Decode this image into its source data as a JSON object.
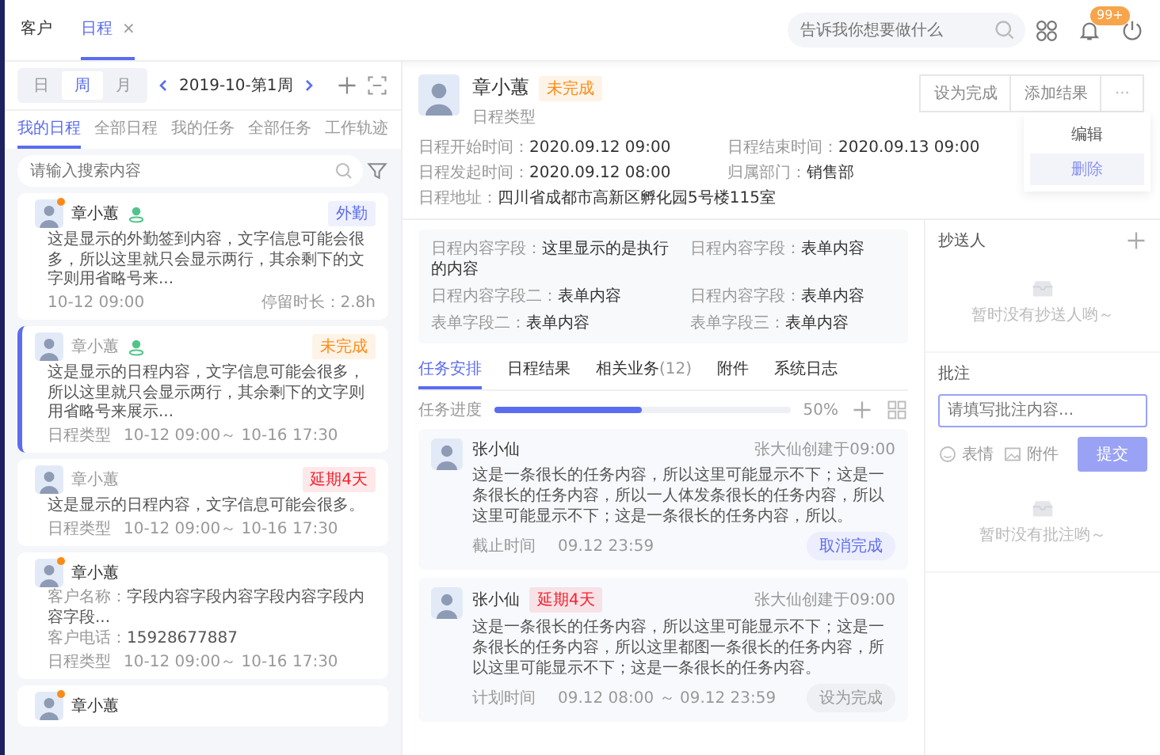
{
  "top_tabs": [
    {
      "label": "客户",
      "selected": false
    },
    {
      "label": "日程",
      "selected": true,
      "close": "×"
    }
  ],
  "global_search": {
    "placeholder": "告诉我你想要做什么"
  },
  "notifications": {
    "badge": "99+"
  },
  "view_switch": [
    {
      "label": "日",
      "selected": false
    },
    {
      "label": "周",
      "selected": true
    },
    {
      "label": "月",
      "selected": false
    }
  ],
  "date_label": "2019-10-第1周",
  "list_tabs": [
    {
      "label": "我的日程",
      "selected": true
    },
    {
      "label": "全部日程",
      "selected": false
    },
    {
      "label": "我的任务",
      "selected": false
    },
    {
      "label": "全部任务",
      "selected": false
    },
    {
      "label": "工作轨迹",
      "selected": false
    }
  ],
  "list_search": {
    "placeholder": "请输入搜索内容"
  },
  "cards": [
    {
      "kind": "checkin",
      "name": "章小蕙",
      "unread": true,
      "located": true,
      "selected": false,
      "tag": {
        "text": "外勤",
        "color": "#5b6cf0"
      },
      "content": "这是显示的外勤签到内容，文字信息可能会很多，所以这里就只会显示两行，其余剩下的文字则用省略号来...",
      "time": "10-12 09:00",
      "duration": "停留时长：2.8h"
    },
    {
      "kind": "schedule",
      "name": "章小蕙",
      "unread": false,
      "located": true,
      "selected": true,
      "tag": {
        "text": "未完成",
        "color": "#fa8c16"
      },
      "content": "这是显示的日程内容，文字信息可能会很多，所以这里就只会显示两行，其余剩下的文字则用省略号来展示...",
      "type": "日程类型",
      "range": "10-12 09:00～ 10-16 17:30"
    },
    {
      "kind": "schedule",
      "name": "章小蕙",
      "unread": false,
      "located": false,
      "selected": false,
      "tag": {
        "text": "延期4天",
        "color": "#f5222d"
      },
      "content": "这是显示的日程内容，文字信息可能会很多。",
      "type": "日程类型",
      "range": "10-12 09:00～ 10-16 17:30"
    },
    {
      "kind": "customer",
      "name": "章小蕙",
      "unread": true,
      "located": false,
      "selected": false,
      "fields": [
        {
          "label": "客户名称：",
          "value": "字段内容字段内容字段内容字段内容字段..."
        },
        {
          "label": "客户电话：",
          "value": "15928677887"
        }
      ],
      "type": "日程类型",
      "range": "10-12 09:00～ 10-16 17:30"
    },
    {
      "kind": "partial",
      "name": "章小蕙",
      "unread": true,
      "located": false,
      "selected": false
    }
  ],
  "detail": {
    "name": "章小蕙",
    "status": {
      "text": "未完成",
      "color": "#fa8c16"
    },
    "type": "日程类型",
    "actions": [
      "设为完成",
      "添加结果"
    ],
    "more": "···",
    "menu": [
      {
        "label": "编辑",
        "selected": false
      },
      {
        "label": "删除",
        "selected": true
      }
    ],
    "info": [
      {
        "label": "日程开始时间：",
        "value": "2020.09.12 09:00"
      },
      {
        "label": "日程结束时间：",
        "value": "2020.09.13 09:00"
      },
      {
        "label": "日程发起时间：",
        "value": "2020.09.12 08:00"
      },
      {
        "label": "归属部门：",
        "value": "销售部"
      },
      {
        "label": "日程地址：",
        "value": "四川省成都市高新区孵化园5号楼115室"
      }
    ],
    "fields": [
      {
        "label": "日程内容字段：",
        "value": "这里显示的是执行的内容"
      },
      {
        "label": "日程内容字段：",
        "value": "表单内容"
      },
      {
        "label": "日程内容字段二：",
        "value": "表单内容"
      },
      {
        "label": "日程内容字段：",
        "value": "表单内容"
      },
      {
        "label": "表单字段二：",
        "value": "表单内容"
      },
      {
        "label": "表单字段三：",
        "value": "表单内容"
      }
    ]
  },
  "detail_tabs": [
    {
      "label": "任务安排",
      "selected": true
    },
    {
      "label": "日程结果",
      "selected": false
    },
    {
      "label": "相关业务",
      "count": "(12)",
      "selected": false
    },
    {
      "label": "附件",
      "selected": false
    },
    {
      "label": "系统日志",
      "selected": false
    }
  ],
  "progress": {
    "label": "任务进度",
    "level": 0.5,
    "reading": "50%"
  },
  "tasks": [
    {
      "name": "张小仙",
      "created": "张大仙创建于09:00",
      "content": "这是一条很长的任务内容，所以这里可能显示不下；这是一条很长的任务内容，所以一人体发条很长的任务内容，所以这里可能显示不下；这是一条很长的任务内容，所以。",
      "time_label": "截止时间",
      "time": "09.12 23:59",
      "action": {
        "text": "取消完成",
        "kind": "primary"
      }
    },
    {
      "name": "张小仙",
      "tag": {
        "text": "延期4天",
        "color": "#f5222d"
      },
      "created": "张大仙创建于09:00",
      "content": "这是一条很长的任务内容，所以这里可能显示不下；这是一条很长的任务内容，所以这里都图一条很长的任务内容，所以这里可能显示不下；这是一条很长的任务内容。",
      "time_label": "计划时间",
      "time": "09.12 08:00 ～ 09.12 23:59",
      "action": {
        "text": "设为完成",
        "kind": "default"
      }
    }
  ],
  "cc": {
    "title": "抄送人",
    "empty": "暂时没有抄送人哟～"
  },
  "comments": {
    "title": "批注",
    "placeholder": "请填写批注内容...",
    "tools": [
      {
        "kind": "emoji",
        "label": "表情"
      },
      {
        "kind": "image",
        "label": "附件"
      }
    ],
    "submit": "提交",
    "empty": "暂时没有批注哟～"
  }
}
